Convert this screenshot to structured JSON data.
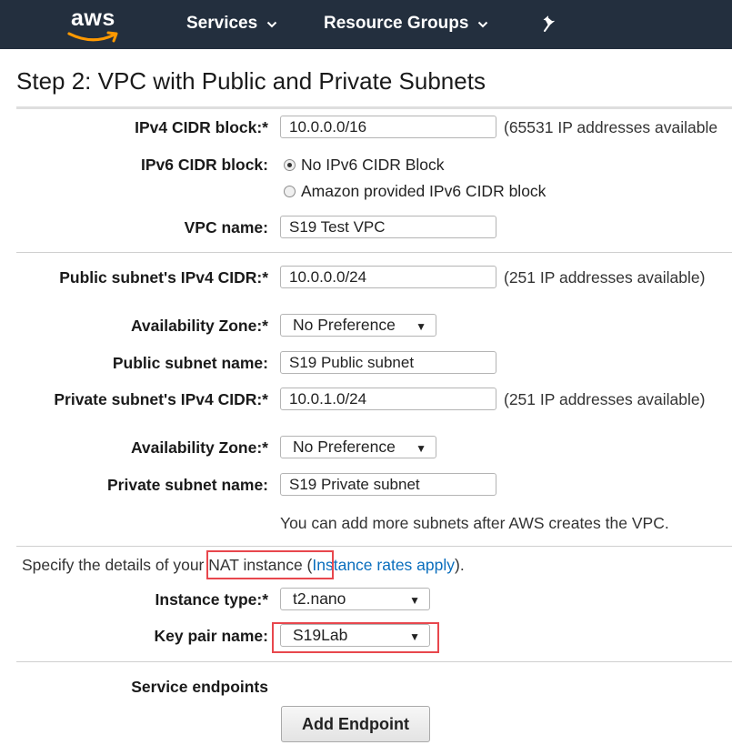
{
  "nav": {
    "logo_text": "aws",
    "services_label": "Services",
    "resource_groups_label": "Resource Groups",
    "pin_icon": "pin-icon",
    "chevron_icon": "chevron-down-icon"
  },
  "page": {
    "title": "Step 2: VPC with Public and Private Subnets"
  },
  "vpc": {
    "ipv4_cidr_label": "IPv4 CIDR block:*",
    "ipv4_cidr_value": "10.0.0.0/16",
    "ipv4_cidr_hint": "(65531 IP addresses available",
    "ipv6_cidr_label": "IPv6 CIDR block:",
    "ipv6_options": [
      "No IPv6 CIDR Block",
      "Amazon provided IPv6 CIDR block"
    ],
    "ipv6_selected": "No IPv6 CIDR Block",
    "name_label": "VPC name:",
    "name_value": "S19 Test VPC"
  },
  "public_subnet": {
    "cidr_label": "Public subnet's IPv4 CIDR:*",
    "cidr_value": "10.0.0.0/24",
    "cidr_hint": "(251 IP addresses available)",
    "az_label": "Availability Zone:*",
    "az_value": "No Preference",
    "name_label": "Public subnet name:",
    "name_value": "S19 Public subnet"
  },
  "private_subnet": {
    "cidr_label": "Private subnet's IPv4 CIDR:*",
    "cidr_value": "10.0.1.0/24",
    "cidr_hint": "(251 IP addresses available)",
    "az_label": "Availability Zone:*",
    "az_value": "No Preference",
    "name_label": "Private subnet name:",
    "name_value": "S19 Private subnet",
    "note": "You can add more subnets after AWS creates the VPC."
  },
  "nat": {
    "intro_prefix": "Specify the details of your NAT instance (",
    "rates_link": "Instance rates apply",
    "intro_suffix": ").",
    "instance_type_label": "Instance type:*",
    "instance_type_value": "t2.nano",
    "key_pair_label": "Key pair name:",
    "key_pair_value": "S19Lab"
  },
  "endpoints": {
    "label": "Service endpoints",
    "add_button": "Add Endpoint"
  },
  "colors": {
    "nav_bg": "#232f3e",
    "aws_orange": "#ff9900",
    "link": "#0a6ebd",
    "highlight_red": "#e8474d"
  }
}
